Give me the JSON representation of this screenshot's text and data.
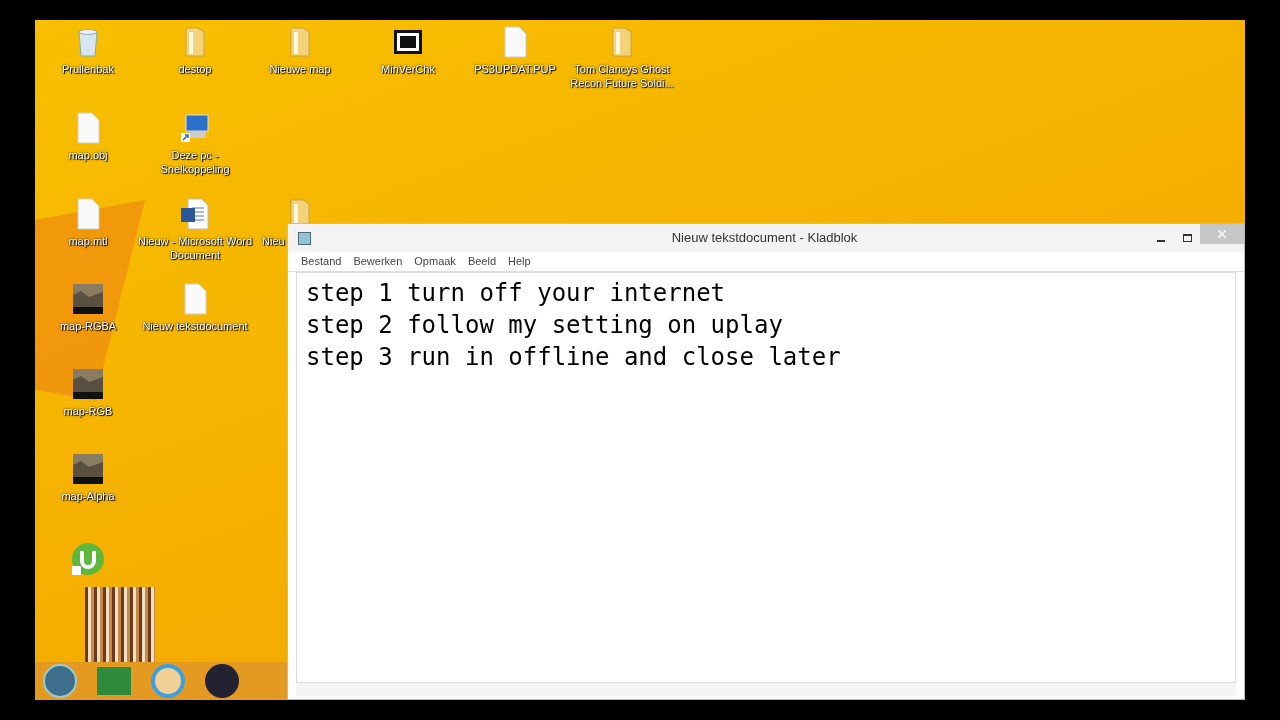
{
  "desktop": {
    "icons": [
      {
        "kind": "recycle",
        "label": "Prullenbak"
      },
      {
        "kind": "folder",
        "label": "destop"
      },
      {
        "kind": "folder",
        "label": "Nieuwe map"
      },
      {
        "kind": "archive",
        "label": "MinVerChk"
      },
      {
        "kind": "file",
        "label": "PS3UPDAT.PUP"
      },
      {
        "kind": "folder",
        "label": "Tom Clancys Ghost Recon Future Soldi..."
      },
      {
        "kind": "file",
        "label": "map.obj"
      },
      {
        "kind": "computer",
        "label": "Deze pc - Snelkoppeling"
      },
      {
        "kind": "file",
        "label": "map.mtl"
      },
      {
        "kind": "word",
        "label": "Nieuw - Microsoft Word Document"
      },
      {
        "kind": "folder",
        "label": "Nieu"
      },
      {
        "kind": "image",
        "label": "map-RGBA"
      },
      {
        "kind": "file",
        "label": "Nieuw tekstdocument"
      },
      {
        "kind": "image",
        "label": "map-RGB"
      },
      {
        "kind": "image",
        "label": "map-Alpha"
      },
      {
        "kind": "torrent"
      }
    ]
  },
  "notepad": {
    "title": "Nieuw tekstdocument - Kladblok",
    "menu": [
      "Bestand",
      "Bewerken",
      "Opmaak",
      "Beeld",
      "Help"
    ],
    "lines": [
      "step 1 turn off your internet",
      "step 2 follow my setting on uplay",
      "step 3 run in offline and close later"
    ]
  }
}
